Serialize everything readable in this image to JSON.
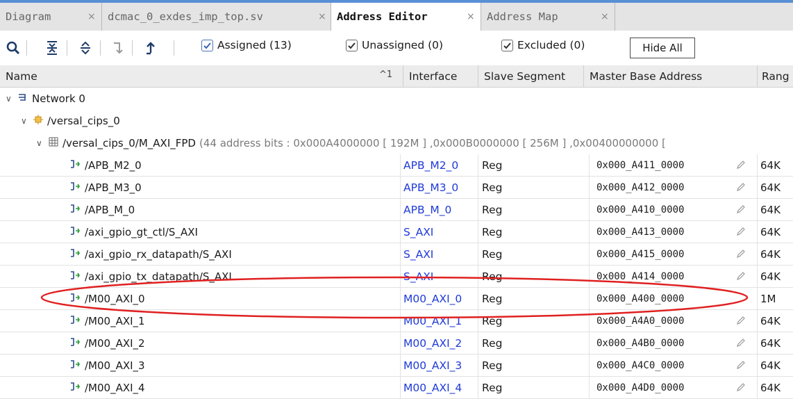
{
  "tabs": [
    {
      "label": "Diagram",
      "active": false
    },
    {
      "label": "dcmac_0_exdes_imp_top.sv",
      "active": false
    },
    {
      "label": "Address Editor",
      "active": true
    },
    {
      "label": "Address Map",
      "active": false
    }
  ],
  "tab_close_glyph": "×",
  "toolbar": {
    "icons": [
      "search-icon",
      "collapse-all-icon",
      "expand-all-icon",
      "unassign-icon",
      "assign-icon"
    ],
    "checks": [
      {
        "label": "Assigned (13)",
        "checked": true
      },
      {
        "label": "Unassigned (0)",
        "checked": true
      },
      {
        "label": "Excluded (0)",
        "checked": true
      }
    ],
    "hide_all_label": "Hide All"
  },
  "columns": {
    "name": "Name",
    "sort_indicator": "^1",
    "interface": "Interface",
    "slave_segment": "Slave Segment",
    "master_base_address": "Master Base Address",
    "range": "Rang"
  },
  "tree": {
    "network": "Network 0",
    "cips": "/versal_cips_0",
    "master": "/versal_cips_0/M_AXI_FPD",
    "master_detail": "(44 address bits : 0x000A4000000 [ 192M ] ,0x000B0000000 [ 256M ] ,0x00400000000 [",
    "rows": [
      {
        "name": "/APB_M2_0",
        "interface": "APB_M2_0",
        "segment": "Reg",
        "address": "0x000_A411_0000",
        "range": "64K"
      },
      {
        "name": "/APB_M3_0",
        "interface": "APB_M3_0",
        "segment": "Reg",
        "address": "0x000_A412_0000",
        "range": "64K"
      },
      {
        "name": "/APB_M_0",
        "interface": "APB_M_0",
        "segment": "Reg",
        "address": "0x000_A410_0000",
        "range": "64K"
      },
      {
        "name": "/axi_gpio_gt_ctl/S_AXI",
        "interface": "S_AXI",
        "segment": "Reg",
        "address": "0x000_A413_0000",
        "range": "64K"
      },
      {
        "name": "/axi_gpio_rx_datapath/S_AXI",
        "interface": "S_AXI",
        "segment": "Reg",
        "address": "0x000_A415_0000",
        "range": "64K"
      },
      {
        "name": "/axi_gpio_tx_datapath/S_AXI",
        "interface": "S_AXI",
        "segment": "Reg",
        "address": "0x000_A414_0000",
        "range": "64K"
      },
      {
        "name": "/M00_AXI_0",
        "interface": "M00_AXI_0",
        "segment": "Reg",
        "address": "0x000_A400_0000",
        "range": "1M"
      },
      {
        "name": "/M00_AXI_1",
        "interface": "M00_AXI_1",
        "segment": "Reg",
        "address": "0x000_A4A0_0000",
        "range": "64K"
      },
      {
        "name": "/M00_AXI_2",
        "interface": "M00_AXI_2",
        "segment": "Reg",
        "address": "0x000_A4B0_0000",
        "range": "64K"
      },
      {
        "name": "/M00_AXI_3",
        "interface": "M00_AXI_3",
        "segment": "Reg",
        "address": "0x000_A4C0_0000",
        "range": "64K"
      },
      {
        "name": "/M00_AXI_4",
        "interface": "M00_AXI_4",
        "segment": "Reg",
        "address": "0x000_A4D0_0000",
        "range": "64K"
      }
    ]
  },
  "colors": {
    "accent": "#5a8fd6",
    "interface_link": "#1f3ad8",
    "annotation": "#e02020"
  }
}
